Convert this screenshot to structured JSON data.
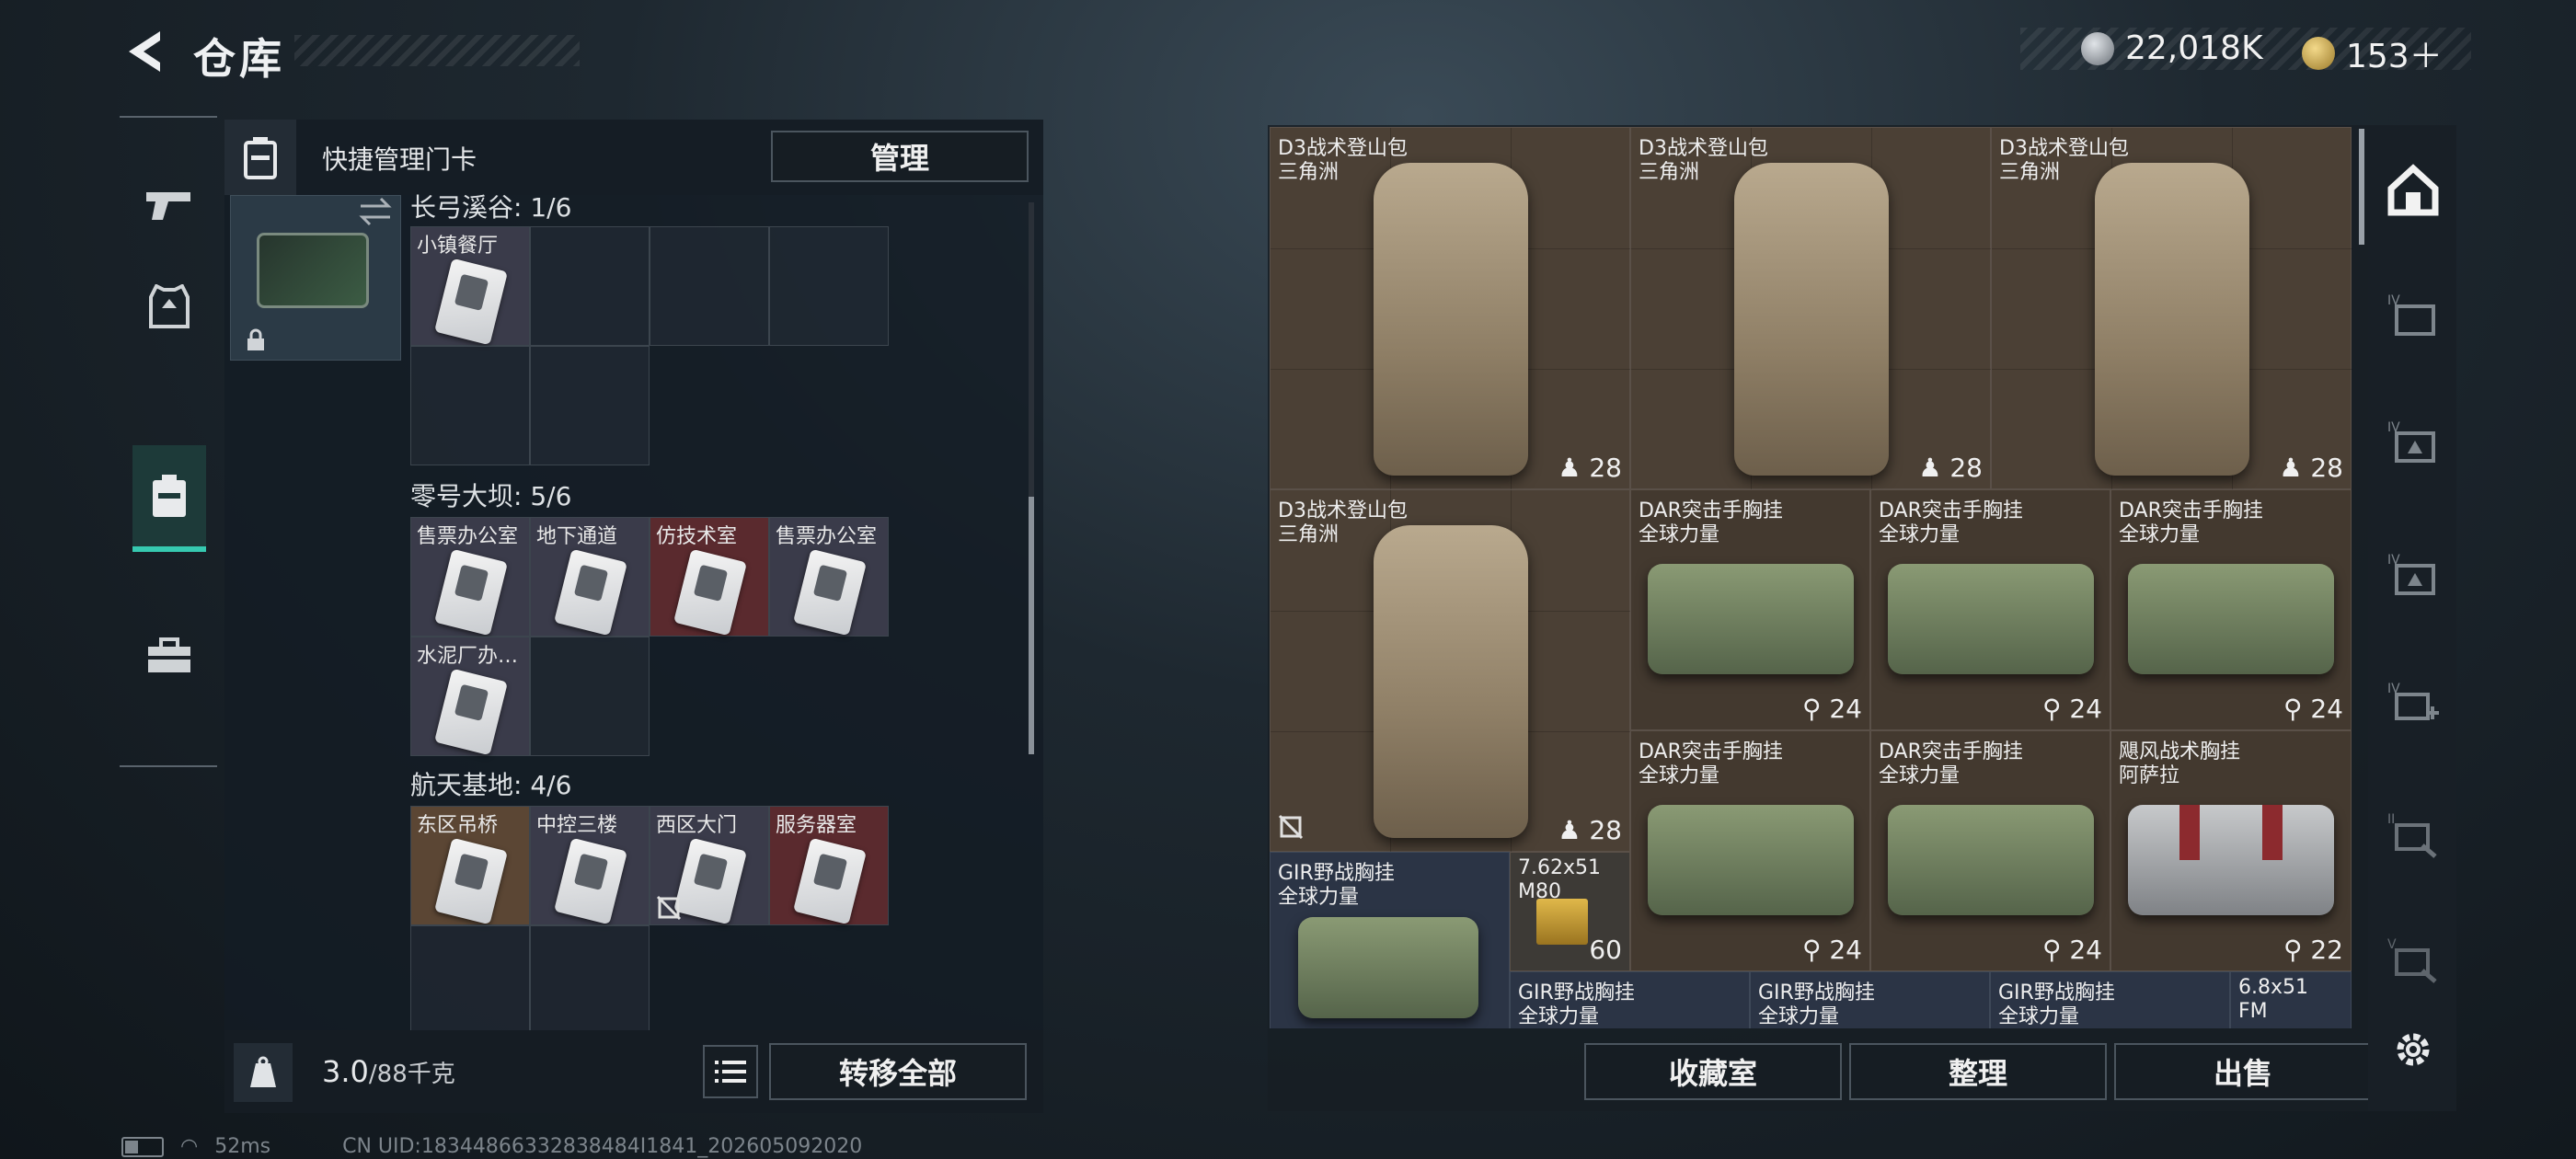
{
  "header": {
    "title": "仓库",
    "currency_1": "22,018K",
    "currency_2": "153＋",
    "currency_1_color": "#c8cdd2",
    "currency_2_color": "#d9b55a"
  },
  "nav": {
    "items": [
      "weapon",
      "armor",
      "keycard",
      "toolbox"
    ],
    "active": "keycard"
  },
  "left_panel": {
    "header_label": "快捷管理门卡",
    "manage_button": "管理",
    "sections": [
      {
        "title": "长弓溪谷: 1/6",
        "cells": [
          {
            "label": "小镇餐厅",
            "style": "filled"
          }
        ]
      },
      {
        "title": "零号大坝: 5/6",
        "cells": [
          {
            "label": "售票办公室",
            "style": "filled"
          },
          {
            "label": "地下通道",
            "style": "filled"
          },
          {
            "label": "仿技术室",
            "style": "red"
          },
          {
            "label": "售票办公室",
            "style": "filled"
          },
          {
            "label": "水泥厂办…",
            "style": "filled"
          }
        ]
      },
      {
        "title": "航天基地: 4/6",
        "cells": [
          {
            "label": "东区吊桥",
            "style": "brown"
          },
          {
            "label": "中控三楼",
            "style": "filled"
          },
          {
            "label": "西区大门",
            "style": "filled"
          },
          {
            "label": "服务器室",
            "style": "red"
          }
        ]
      }
    ],
    "weight_current": "3.0",
    "weight_max": "/88千克",
    "transfer_button": "转移全部"
  },
  "right_panel": {
    "items": [
      {
        "name": "D3战术登山包",
        "sub": "三角洲",
        "count": "28"
      },
      {
        "name": "D3战术登山包",
        "sub": "三角洲",
        "count": "28"
      },
      {
        "name": "D3战术登山包",
        "sub": "三角洲",
        "count": "28"
      },
      {
        "name": "D3战术登山包",
        "sub": "三角洲",
        "count": "28"
      },
      {
        "name": "DAR突击手胸挂",
        "sub": "全球力量",
        "count": "24"
      },
      {
        "name": "DAR突击手胸挂",
        "sub": "全球力量",
        "count": "24"
      },
      {
        "name": "DAR突击手胸挂",
        "sub": "全球力量",
        "count": "24"
      },
      {
        "name": "DAR突击手胸挂",
        "sub": "全球力量",
        "count": "24"
      },
      {
        "name": "DAR突击手胸挂",
        "sub": "全球力量",
        "count": "24"
      },
      {
        "name": "飓风战术胸挂",
        "sub": "阿萨拉",
        "count": "22"
      },
      {
        "name": "GIR野战胸挂",
        "sub": "全球力量",
        "count": ""
      },
      {
        "name": "7.62x51",
        "sub": "M80",
        "count": "60"
      },
      {
        "name": "GIR野战胸挂",
        "sub": "全球力量",
        "count": ""
      },
      {
        "name": "GIR野战胸挂",
        "sub": "全球力量",
        "count": ""
      },
      {
        "name": "GIR野战胸挂",
        "sub": "全球力量",
        "count": ""
      },
      {
        "name": "6.8x51",
        "sub": "FM",
        "count": ""
      }
    ],
    "buttons": [
      "收藏室",
      "整理",
      "出售"
    ]
  },
  "side_icons": [
    "home-icon",
    "tier4-box-icon",
    "tier4-diamond-icon",
    "tier4-diamond-icon",
    "tier4-add-icon",
    "tier2-tool-icon",
    "tier5-tool-icon",
    "settings-icon"
  ],
  "status": {
    "ping": "52ms",
    "uid": "CN UID:18344866332838484I1841_202605092020"
  }
}
